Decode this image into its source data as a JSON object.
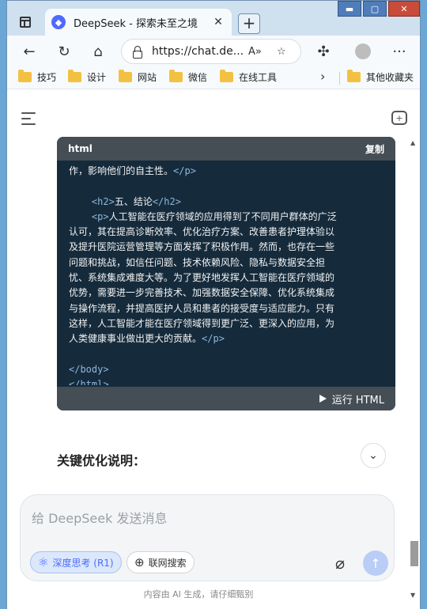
{
  "browser": {
    "tab_title": "DeepSeek - 探索未至之境",
    "tab_favicon": "deepseek-whale",
    "tab_close": "✕",
    "new_tab": "+",
    "window_controls": [
      "▬",
      "▢",
      "✕"
    ],
    "url": "https://chat.de...",
    "bookmarks": [
      "技巧",
      "设计",
      "网站",
      "微信",
      "在线工具"
    ],
    "other_bookmarks": "其他收藏夹"
  },
  "code_block": {
    "language": "html",
    "copy_label": "复制",
    "run_label": "运行 HTML",
    "lines": [
      {
        "text": "作，影响他们的自主性。",
        "tag_after": "</p>"
      },
      {
        "text": ""
      },
      {
        "indent": "    ",
        "tag_before": "<h2>",
        "text": "五、结论",
        "tag_after": "</h2>"
      },
      {
        "indent": "    ",
        "tag_before": "<p>",
        "text": "人工智能在医疗领域的应用得到了不同用户群体的广泛"
      },
      {
        "text": "认可，其在提高诊断效率、优化治疗方案、改善患者护理体验以"
      },
      {
        "text": "及提升医院运营管理等方面发挥了积极作用。然而，也存在一些"
      },
      {
        "text": "问题和挑战，如信任问题、技术依赖风险、隐私与数据安全担"
      },
      {
        "text": "忧、系统集成难度大等。为了更好地发挥人工智能在医疗领域的"
      },
      {
        "text": "优势，需要进一步完善技术、加强数据安全保障、优化系统集成"
      },
      {
        "text": "与操作流程，并提高医护人员和患者的接受度与适应能力。只有"
      },
      {
        "text": "这样，人工智能才能在医疗领域得到更广泛、更深入的应用，为"
      },
      {
        "text": "人类健康事业做出更大的贡献。",
        "tag_after": "</p>"
      },
      {
        "text": ""
      },
      {
        "tag_before": "</body>",
        "text": ""
      },
      {
        "tag_before": "</html>",
        "text": ""
      }
    ]
  },
  "section_title": "关键优化说明：",
  "input": {
    "placeholder": "给 DeepSeek 发送消息",
    "deep_think": "深度思考 (R1)",
    "web_search": "联网搜索"
  },
  "disclaimer": "内容由 AI 生成，请仔细甄别",
  "colors": {
    "accent": "#4d6bfe",
    "code_bg": "#152b3c",
    "code_header": "#454d55",
    "tag_color": "#8fb6dc"
  }
}
